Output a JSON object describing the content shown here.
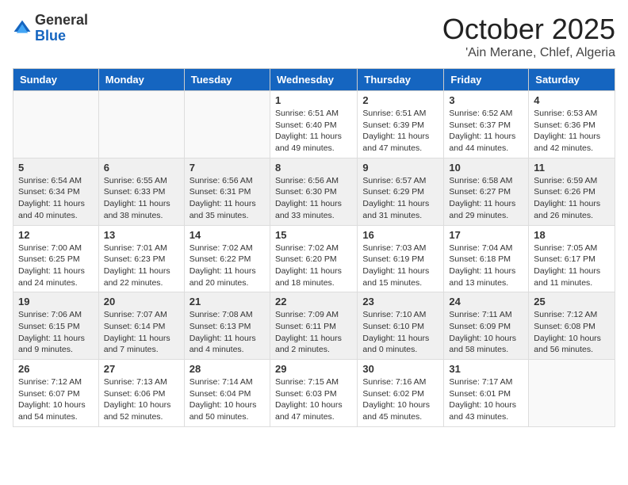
{
  "header": {
    "logo_general": "General",
    "logo_blue": "Blue",
    "month_year": "October 2025",
    "location": "'Ain Merane, Chlef, Algeria"
  },
  "days_of_week": [
    "Sunday",
    "Monday",
    "Tuesday",
    "Wednesday",
    "Thursday",
    "Friday",
    "Saturday"
  ],
  "weeks": [
    [
      {
        "day": "",
        "info": ""
      },
      {
        "day": "",
        "info": ""
      },
      {
        "day": "",
        "info": ""
      },
      {
        "day": "1",
        "info": "Sunrise: 6:51 AM\nSunset: 6:40 PM\nDaylight: 11 hours and 49 minutes."
      },
      {
        "day": "2",
        "info": "Sunrise: 6:51 AM\nSunset: 6:39 PM\nDaylight: 11 hours and 47 minutes."
      },
      {
        "day": "3",
        "info": "Sunrise: 6:52 AM\nSunset: 6:37 PM\nDaylight: 11 hours and 44 minutes."
      },
      {
        "day": "4",
        "info": "Sunrise: 6:53 AM\nSunset: 6:36 PM\nDaylight: 11 hours and 42 minutes."
      }
    ],
    [
      {
        "day": "5",
        "info": "Sunrise: 6:54 AM\nSunset: 6:34 PM\nDaylight: 11 hours and 40 minutes."
      },
      {
        "day": "6",
        "info": "Sunrise: 6:55 AM\nSunset: 6:33 PM\nDaylight: 11 hours and 38 minutes."
      },
      {
        "day": "7",
        "info": "Sunrise: 6:56 AM\nSunset: 6:31 PM\nDaylight: 11 hours and 35 minutes."
      },
      {
        "day": "8",
        "info": "Sunrise: 6:56 AM\nSunset: 6:30 PM\nDaylight: 11 hours and 33 minutes."
      },
      {
        "day": "9",
        "info": "Sunrise: 6:57 AM\nSunset: 6:29 PM\nDaylight: 11 hours and 31 minutes."
      },
      {
        "day": "10",
        "info": "Sunrise: 6:58 AM\nSunset: 6:27 PM\nDaylight: 11 hours and 29 minutes."
      },
      {
        "day": "11",
        "info": "Sunrise: 6:59 AM\nSunset: 6:26 PM\nDaylight: 11 hours and 26 minutes."
      }
    ],
    [
      {
        "day": "12",
        "info": "Sunrise: 7:00 AM\nSunset: 6:25 PM\nDaylight: 11 hours and 24 minutes."
      },
      {
        "day": "13",
        "info": "Sunrise: 7:01 AM\nSunset: 6:23 PM\nDaylight: 11 hours and 22 minutes."
      },
      {
        "day": "14",
        "info": "Sunrise: 7:02 AM\nSunset: 6:22 PM\nDaylight: 11 hours and 20 minutes."
      },
      {
        "day": "15",
        "info": "Sunrise: 7:02 AM\nSunset: 6:20 PM\nDaylight: 11 hours and 18 minutes."
      },
      {
        "day": "16",
        "info": "Sunrise: 7:03 AM\nSunset: 6:19 PM\nDaylight: 11 hours and 15 minutes."
      },
      {
        "day": "17",
        "info": "Sunrise: 7:04 AM\nSunset: 6:18 PM\nDaylight: 11 hours and 13 minutes."
      },
      {
        "day": "18",
        "info": "Sunrise: 7:05 AM\nSunset: 6:17 PM\nDaylight: 11 hours and 11 minutes."
      }
    ],
    [
      {
        "day": "19",
        "info": "Sunrise: 7:06 AM\nSunset: 6:15 PM\nDaylight: 11 hours and 9 minutes."
      },
      {
        "day": "20",
        "info": "Sunrise: 7:07 AM\nSunset: 6:14 PM\nDaylight: 11 hours and 7 minutes."
      },
      {
        "day": "21",
        "info": "Sunrise: 7:08 AM\nSunset: 6:13 PM\nDaylight: 11 hours and 4 minutes."
      },
      {
        "day": "22",
        "info": "Sunrise: 7:09 AM\nSunset: 6:11 PM\nDaylight: 11 hours and 2 minutes."
      },
      {
        "day": "23",
        "info": "Sunrise: 7:10 AM\nSunset: 6:10 PM\nDaylight: 11 hours and 0 minutes."
      },
      {
        "day": "24",
        "info": "Sunrise: 7:11 AM\nSunset: 6:09 PM\nDaylight: 10 hours and 58 minutes."
      },
      {
        "day": "25",
        "info": "Sunrise: 7:12 AM\nSunset: 6:08 PM\nDaylight: 10 hours and 56 minutes."
      }
    ],
    [
      {
        "day": "26",
        "info": "Sunrise: 7:12 AM\nSunset: 6:07 PM\nDaylight: 10 hours and 54 minutes."
      },
      {
        "day": "27",
        "info": "Sunrise: 7:13 AM\nSunset: 6:06 PM\nDaylight: 10 hours and 52 minutes."
      },
      {
        "day": "28",
        "info": "Sunrise: 7:14 AM\nSunset: 6:04 PM\nDaylight: 10 hours and 50 minutes."
      },
      {
        "day": "29",
        "info": "Sunrise: 7:15 AM\nSunset: 6:03 PM\nDaylight: 10 hours and 47 minutes."
      },
      {
        "day": "30",
        "info": "Sunrise: 7:16 AM\nSunset: 6:02 PM\nDaylight: 10 hours and 45 minutes."
      },
      {
        "day": "31",
        "info": "Sunrise: 7:17 AM\nSunset: 6:01 PM\nDaylight: 10 hours and 43 minutes."
      },
      {
        "day": "",
        "info": ""
      }
    ]
  ]
}
